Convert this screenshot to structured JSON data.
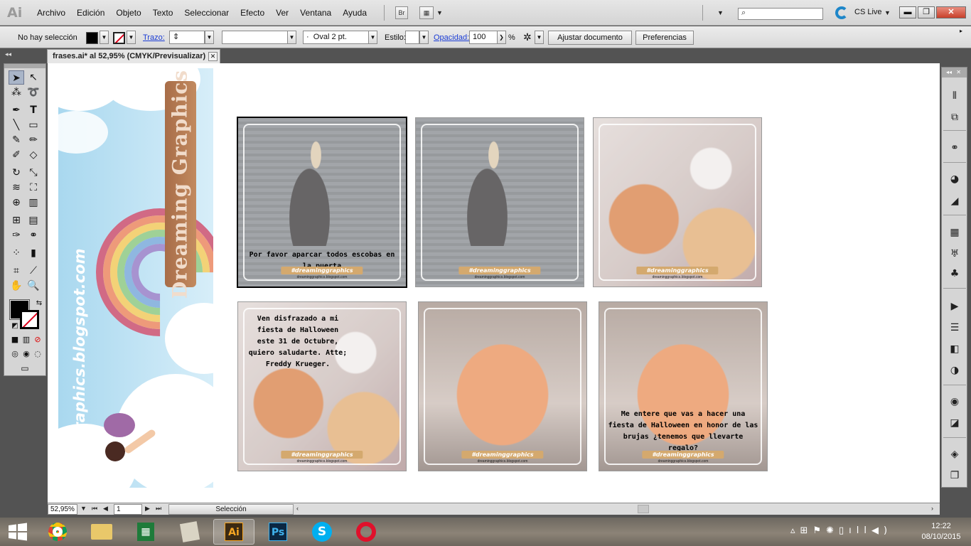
{
  "app": {
    "logo": "Ai"
  },
  "menu": [
    "Archivo",
    "Edición",
    "Objeto",
    "Texto",
    "Seleccionar",
    "Efecto",
    "Ver",
    "Ventana",
    "Ayuda"
  ],
  "menubar": {
    "bridge_label": "Br",
    "cslive_label": "CS Live"
  },
  "controlbar": {
    "selection_label": "No hay selección",
    "stroke_label": "Trazo:",
    "brush_value": "Oval 2 pt.",
    "style_label": "Estilo:",
    "opacity_label": "Opacidad:",
    "opacity_value": "100",
    "percent": "%",
    "fit_button": "Ajustar documento",
    "prefs_button": "Preferencias"
  },
  "document": {
    "tab_title": "frases.ai* al 52,95% (CMYK/Previsualizar)"
  },
  "banner": {
    "title": "Dreaming Graphics",
    "url": "dreaminggraphics.blogspot.com"
  },
  "posts": [
    {
      "caption": "Por favor aparcar todos escobas en la puerta",
      "tag": "#dreaminggraphics",
      "url": "dreaminggraphics.blogspot.com"
    },
    {
      "caption": "",
      "tag": "#dreaminggraphics",
      "url": "dreaminggraphics.blogspot.com"
    },
    {
      "caption": "",
      "tag": "#dreaminggraphics",
      "url": "dreaminggraphics.blogspot.com"
    },
    {
      "caption": "Ven disfrazado a mi fiesta de Halloween este 31 de Octubre, quiero saludarte. Atte; Freddy Krueger.",
      "tag": "#dreaminggraphics",
      "url": "dreaminggraphics.blogspot.com"
    },
    {
      "caption": "",
      "tag": "#dreaminggraphics",
      "url": "dreaminggraphics.blogspot.com"
    },
    {
      "caption": "Me entere que vas a hacer una fiesta de Halloween en honor de las brujas ¿tenemos que llevarte regalo?",
      "tag": "#dreaminggraphics",
      "url": "dreaminggraphics.blogspot.com"
    }
  ],
  "statusbar": {
    "zoom": "52,95%",
    "page": "1",
    "status": "Selección"
  },
  "taskbar": {
    "photoshop": "Ps",
    "illustrator": "Ai",
    "time": "12:22",
    "date": "08/10/2015"
  },
  "colors": {
    "accent_blue": "#1d86c9",
    "tag_gold": "#d4a96e",
    "close_red": "#c8402b"
  }
}
